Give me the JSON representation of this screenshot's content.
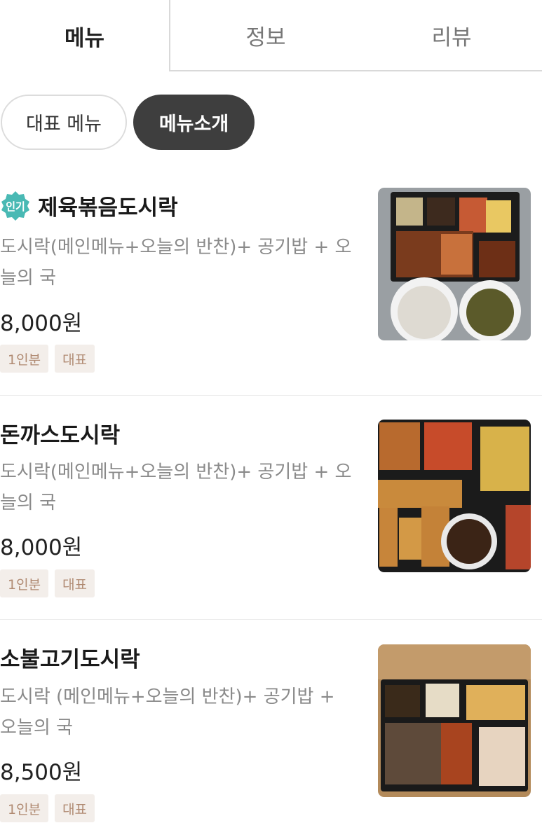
{
  "tabs": [
    {
      "label": "메뉴",
      "active": true
    },
    {
      "label": "정보",
      "active": false
    },
    {
      "label": "리뷰",
      "active": false
    }
  ],
  "chips": [
    {
      "label": "대표 메뉴",
      "selected": false
    },
    {
      "label": "메뉴소개",
      "selected": true
    }
  ],
  "badge_popular": "인기",
  "menu_items": [
    {
      "name": "제육볶음도시락",
      "popular": true,
      "desc_line1": "도시락(메인메뉴+오늘의 반찬)+ 공기밥 + 오",
      "desc_line2": "늘의 국",
      "price": "8,000원",
      "tags": [
        "1인분",
        "대표"
      ],
      "image_icon": "jeyuk-lunchbox-photo"
    },
    {
      "name": "돈까스도시락",
      "popular": false,
      "desc_line1": "도시락(메인메뉴+오늘의 반찬)+ 공기밥 + 오",
      "desc_line2": "늘의 국",
      "price": "8,000원",
      "tags": [
        "1인분",
        "대표"
      ],
      "image_icon": "donkatsu-lunchbox-photo"
    },
    {
      "name": "소불고기도시락",
      "popular": false,
      "desc_line1": "도시락 (메인메뉴+오늘의 반찬)+ 공기밥 +",
      "desc_line2": "오늘의 국",
      "price": "8,500원",
      "tags": [
        "1인분",
        "대표"
      ],
      "image_icon": "bulgogi-lunchbox-photo"
    }
  ],
  "colors": {
    "badge_teal": "#49b9b4",
    "chip_selected_bg": "#3e3e3e",
    "tag_bg": "#f3eeea",
    "tag_text": "#b08a72"
  }
}
